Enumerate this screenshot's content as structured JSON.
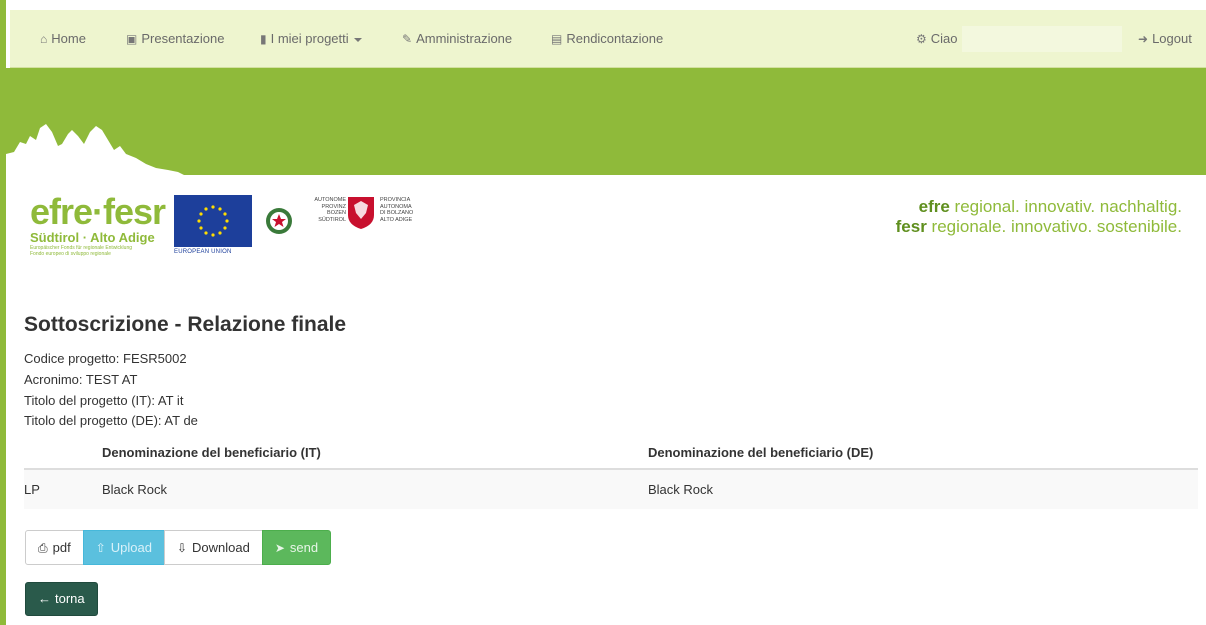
{
  "nav": {
    "home": "Home",
    "presentazione": "Presentazione",
    "progetti": "I miei progetti",
    "amministrazione": "Amministrazione",
    "rendicontazione": "Rendicontazione",
    "ciao": "Ciao",
    "user": "",
    "logout": "Logout"
  },
  "icons": {
    "home": "home-icon",
    "presentazione": "briefcase-icon",
    "progetti": "book-icon",
    "amministrazione": "pencil-icon",
    "rendicontazione": "money-icon",
    "ciao": "gear-icon",
    "logout": "logout-icon"
  },
  "logos": {
    "efre_word": "efre·fesr",
    "efre_sub": "Südtirol · Alto Adige",
    "efre_tiny1": "Europäischer Fonds für regionale Entwicklung",
    "efre_tiny2": "Fondo europeo di sviluppo regionale",
    "eu_caption": "EUROPEAN UNION",
    "prov_left": [
      "AUTONOME",
      "PROVINZ",
      "BOZEN",
      "SÜDTIROL"
    ],
    "prov_right": [
      "PROVINCIA",
      "AUTONOMA",
      "DI BOLZANO",
      "ALTO ADIGE"
    ],
    "slogan1_bold": "efre",
    "slogan1_rest": " regional. innovativ. nachhaltig.",
    "slogan2_bold": "fesr",
    "slogan2_rest": " regionale. innovativo. sostenibile."
  },
  "page": {
    "title": "Sottoscrizione - Relazione finale",
    "codice": "Codice progetto: FESR5002",
    "acronimo": "Acronimo: TEST AT",
    "titolo_it": "Titolo del progetto (IT): AT it",
    "titolo_de": "Titolo del progetto (DE): AT de"
  },
  "table": {
    "headers": [
      "",
      "Denominazione del beneficiario (IT)",
      "Denominazione del beneficiario (DE)"
    ],
    "rows": [
      [
        "LP",
        "Black Rock",
        "Black Rock"
      ]
    ]
  },
  "buttons": {
    "pdf": "pdf",
    "upload": "Upload",
    "download": "Download",
    "send": "send",
    "back": "torna"
  },
  "colors": {
    "brand_green": "#8fba3a",
    "upload_info": "#5bc0de",
    "send_success": "#5cb85c",
    "back_dark": "#2a5a4b"
  }
}
